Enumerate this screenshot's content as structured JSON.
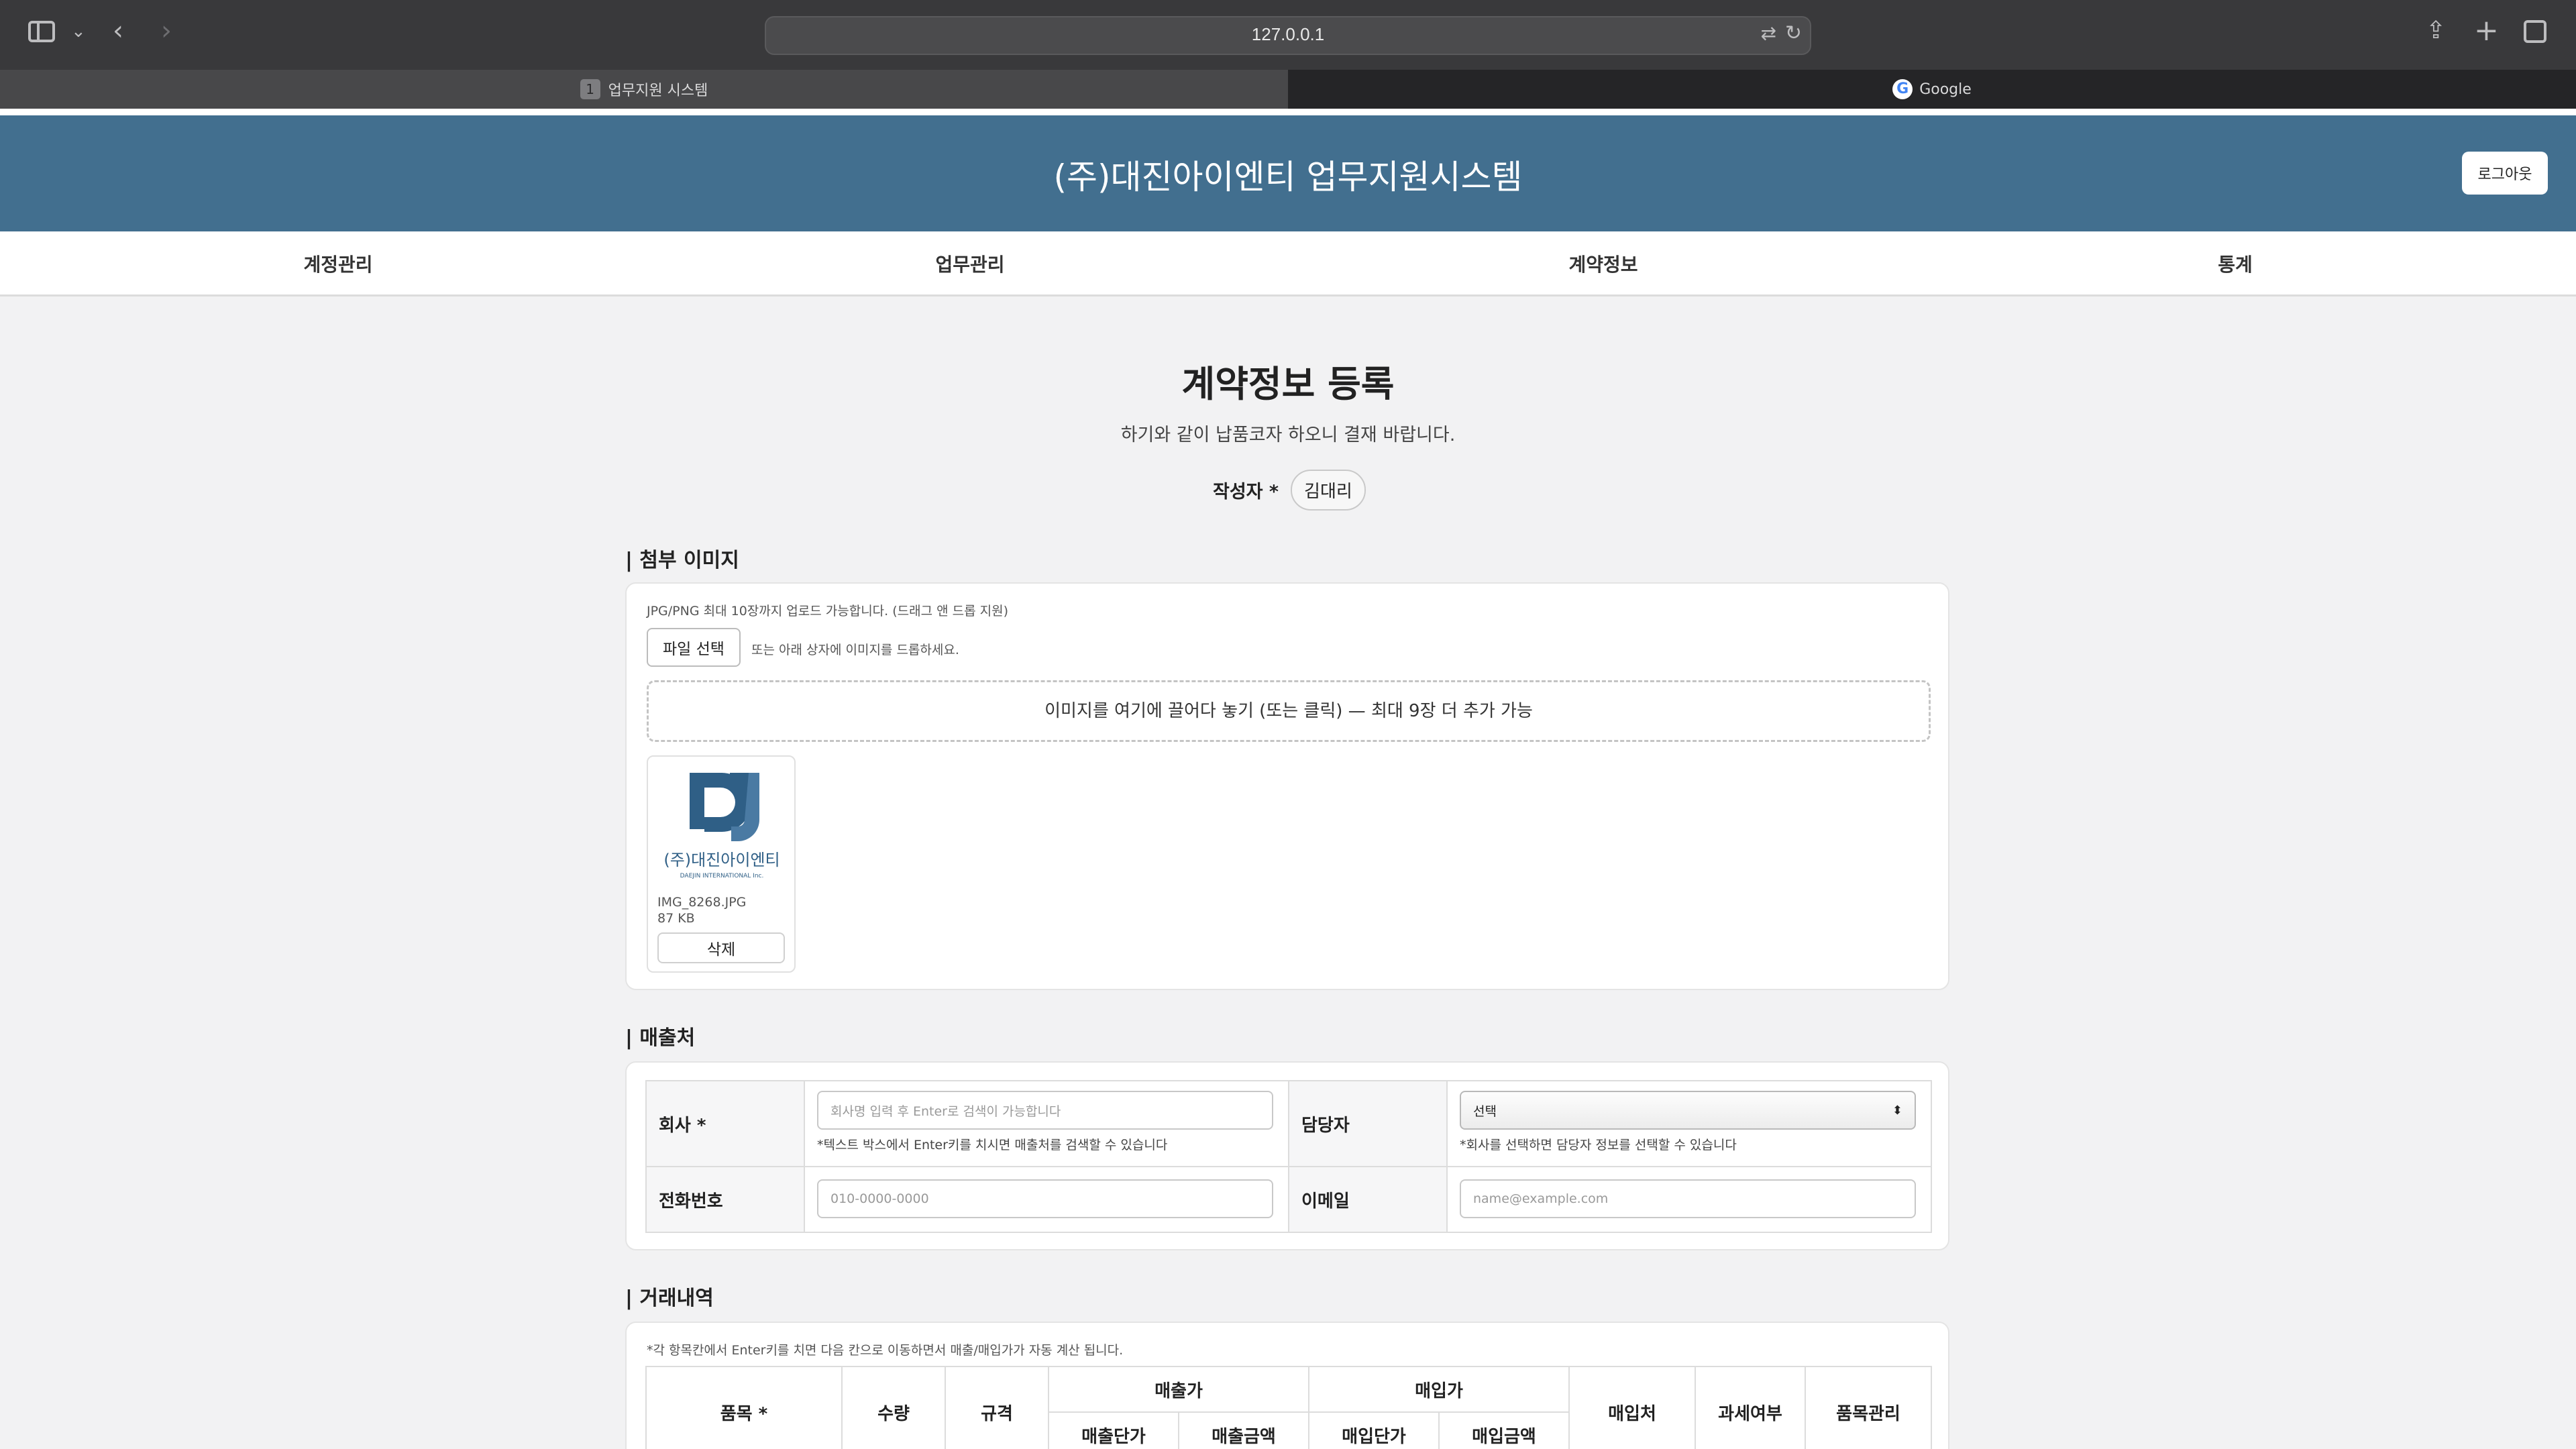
{
  "browser": {
    "url": "127.0.0.1",
    "tabs": [
      {
        "number": "1",
        "title": "업무지원 시스템"
      },
      {
        "title": "Google"
      }
    ]
  },
  "header": {
    "title": "(주)대진아이엔티 업무지원시스템",
    "logout_label": "로그아웃",
    "brand_color": "#426f8f"
  },
  "nav": {
    "items": [
      "계정관리",
      "업무관리",
      "계약정보",
      "통계"
    ]
  },
  "page": {
    "title": "계약정보 등록",
    "subtitle": "하기와 같이 납품코자 하오니 결재 바랍니다.",
    "author_label": "작성자 *",
    "author_value": "김대리"
  },
  "attachments": {
    "section_title": "| 첨부 이미지",
    "hint": "JPG/PNG 최대 10장까지 업로드 가능합니다. (드래그 앤 드롭 지원)",
    "file_button": "파일 선택",
    "file_hint": "또는 아래 상자에 이미지를 드롭하세요.",
    "dropzone_text": "이미지를 여기에 끌어다 놓기 (또는 클릭) — 최대 9장 더 추가 가능",
    "files": [
      {
        "name": "IMG_8268.JPG",
        "size": "87 KB",
        "delete_label": "삭제",
        "logo_text": "(주)대진아이엔티",
        "logo_sub": "DAEJIN INTERNATIONAL Inc."
      }
    ]
  },
  "sales": {
    "section_title": "| 매출처",
    "company_label": "회사 *",
    "company_placeholder": "회사명 입력 후 Enter로 검색이 가능합니다",
    "company_note": "*텍스트 박스에서 Enter키를 치시면 매출처를 검색할 수 있습니다",
    "manager_label": "담당자",
    "manager_value": "선택",
    "manager_note": "*회사를 선택하면 담당자 정보를 선택할 수 있습니다",
    "phone_label": "전화번호",
    "phone_placeholder": "010-0000-0000",
    "email_label": "이메일",
    "email_placeholder": "name@example.com"
  },
  "transactions": {
    "section_title": "| 거래내역",
    "hint": "*각 항목칸에서 Enter키를 치면 다음 칸으로 이동하면서 매출/매입가가 자동 계산 됩니다.",
    "headers": {
      "item": "품목 *",
      "qty": "수량",
      "spec": "규격",
      "sales_price": "매출가",
      "sales_unit": "매출단가",
      "sales_amount": "매출금액",
      "purchase_price": "매입가",
      "purchase_unit": "매입단가",
      "purchase_amount": "매입금액",
      "vendor": "매입처",
      "tax": "과세여부",
      "manage": "품목관리"
    }
  }
}
